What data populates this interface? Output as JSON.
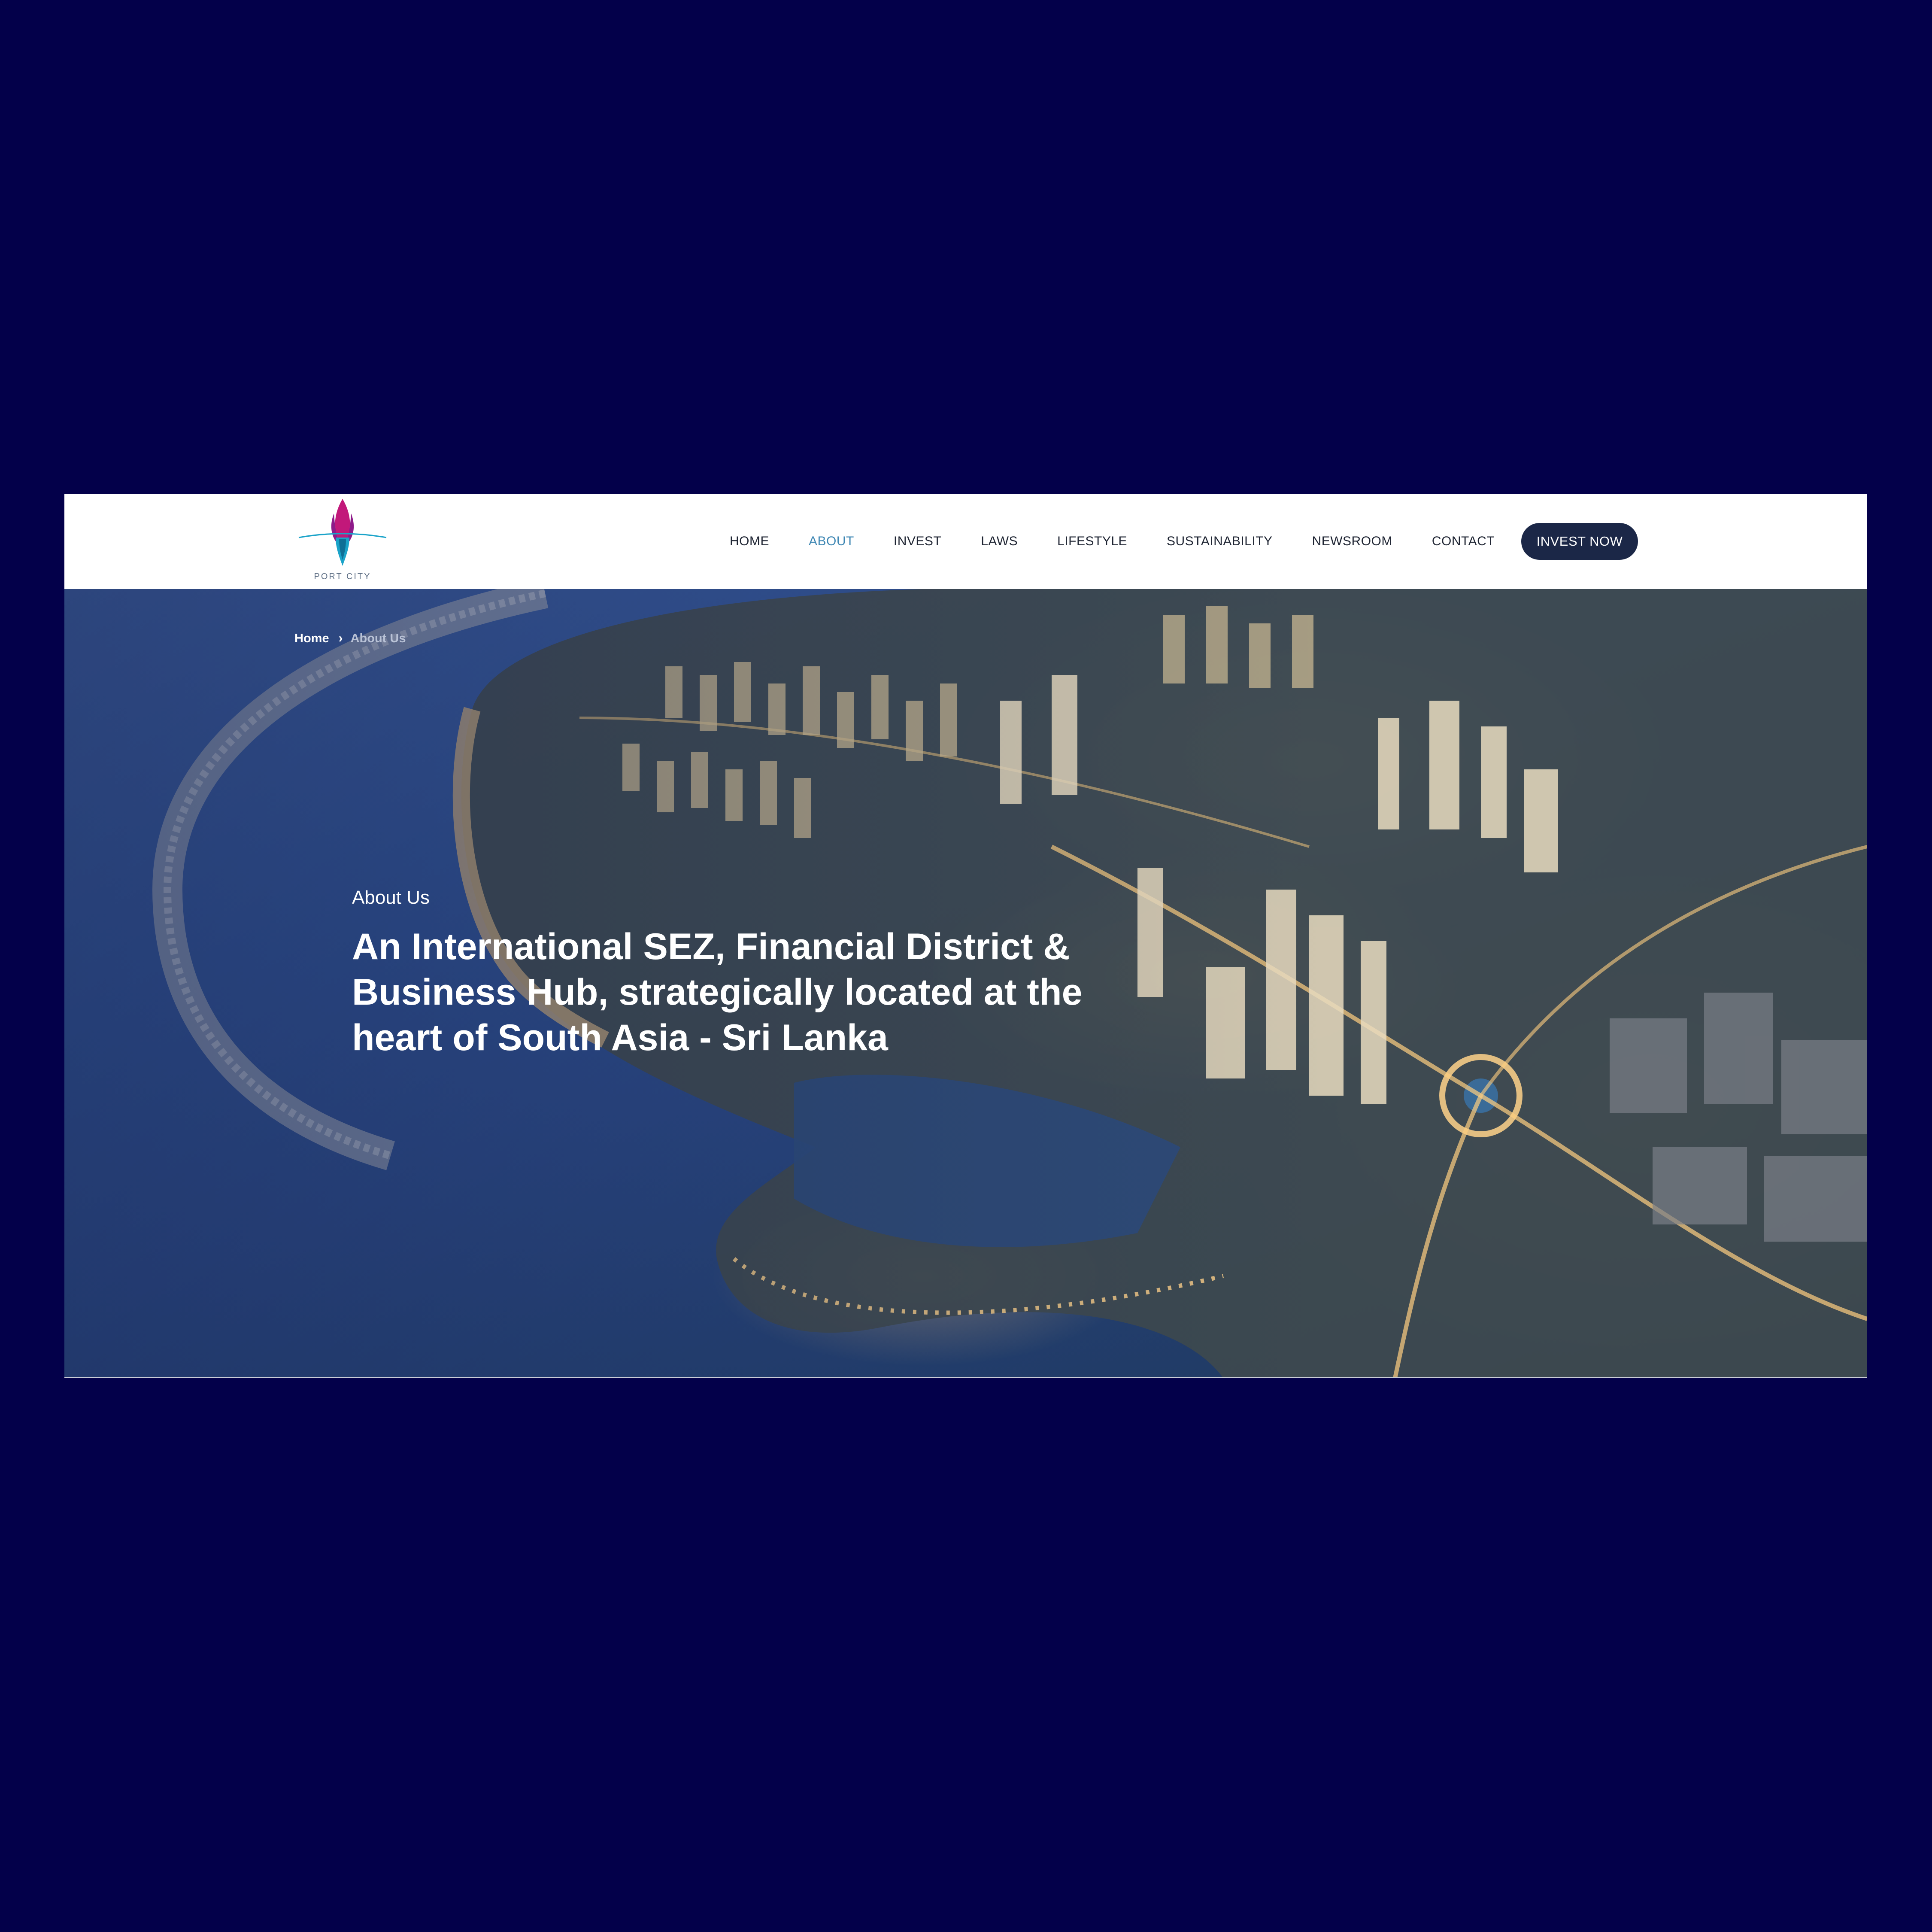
{
  "header": {
    "logo_text": "PORT CITY",
    "nav": [
      {
        "label": "HOME"
      },
      {
        "label": "ABOUT"
      },
      {
        "label": "INVEST"
      },
      {
        "label": "LAWS"
      },
      {
        "label": "LIFESTYLE"
      },
      {
        "label": "SUSTAINABILITY"
      },
      {
        "label": "NEWSROOM"
      },
      {
        "label": "CONTACT"
      }
    ],
    "active_nav": "ABOUT",
    "cta_label": "INVEST NOW"
  },
  "breadcrumb": {
    "home": "Home",
    "separator_icon": "chevron-right-icon",
    "current": "About Us"
  },
  "hero": {
    "kicker": "About Us",
    "title": "An International SEZ, Financial District & Business Hub, strategically located at the heart of South Asia - Sri Lanka",
    "image_alt": "aerial night view of port city"
  },
  "colors": {
    "page_background": "#03004a",
    "nav_active": "#3d86b3",
    "cta_background": "#1b2747",
    "logo_magenta": "#c2187a",
    "logo_cyan": "#1aa3c9"
  }
}
